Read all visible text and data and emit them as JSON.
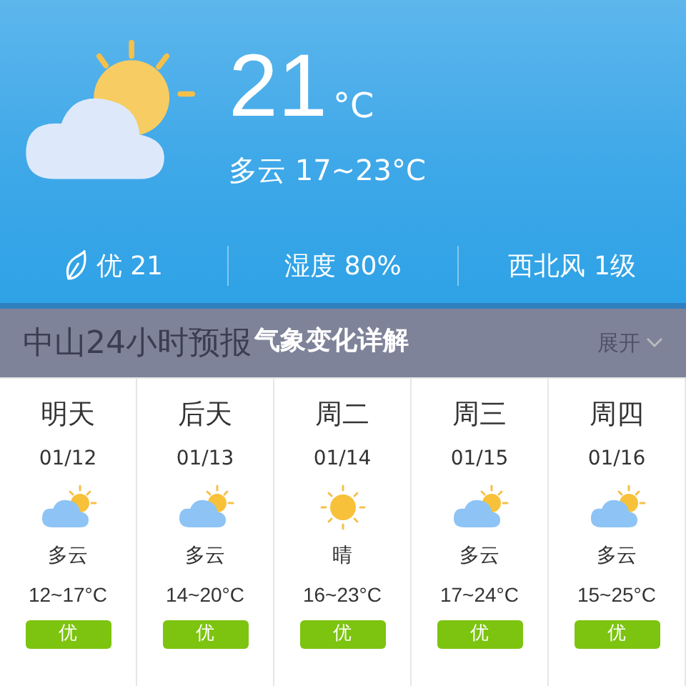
{
  "current": {
    "temperature": "21",
    "unit": "°C",
    "summary": "多云 17~23°C",
    "kind": "cloudy"
  },
  "stats": [
    {
      "kind": "aqi",
      "text": "优 21"
    },
    {
      "kind": "plain",
      "text": "湿度 80%"
    },
    {
      "kind": "plain",
      "text": "西北风 1级"
    }
  ],
  "forecast_header": {
    "title": "中山24小时预报",
    "toggle": "展开"
  },
  "banner": {
    "title": "气象变化详解"
  },
  "days": [
    {
      "name": "明天",
      "date": "01/12",
      "kind": "cloudy",
      "condition": "多云",
      "temp": "12~17°C",
      "aqi": "优"
    },
    {
      "name": "后天",
      "date": "01/13",
      "kind": "cloudy",
      "condition": "多云",
      "temp": "14~20°C",
      "aqi": "优"
    },
    {
      "name": "周二",
      "date": "01/14",
      "kind": "sunny",
      "condition": "晴",
      "temp": "16~23°C",
      "aqi": "优"
    },
    {
      "name": "周三",
      "date": "01/15",
      "kind": "cloudy",
      "condition": "多云",
      "temp": "17~24°C",
      "aqi": "优"
    },
    {
      "name": "周四",
      "date": "01/16",
      "kind": "cloudy",
      "condition": "多云",
      "temp": "15~25°C",
      "aqi": "优"
    }
  ]
}
